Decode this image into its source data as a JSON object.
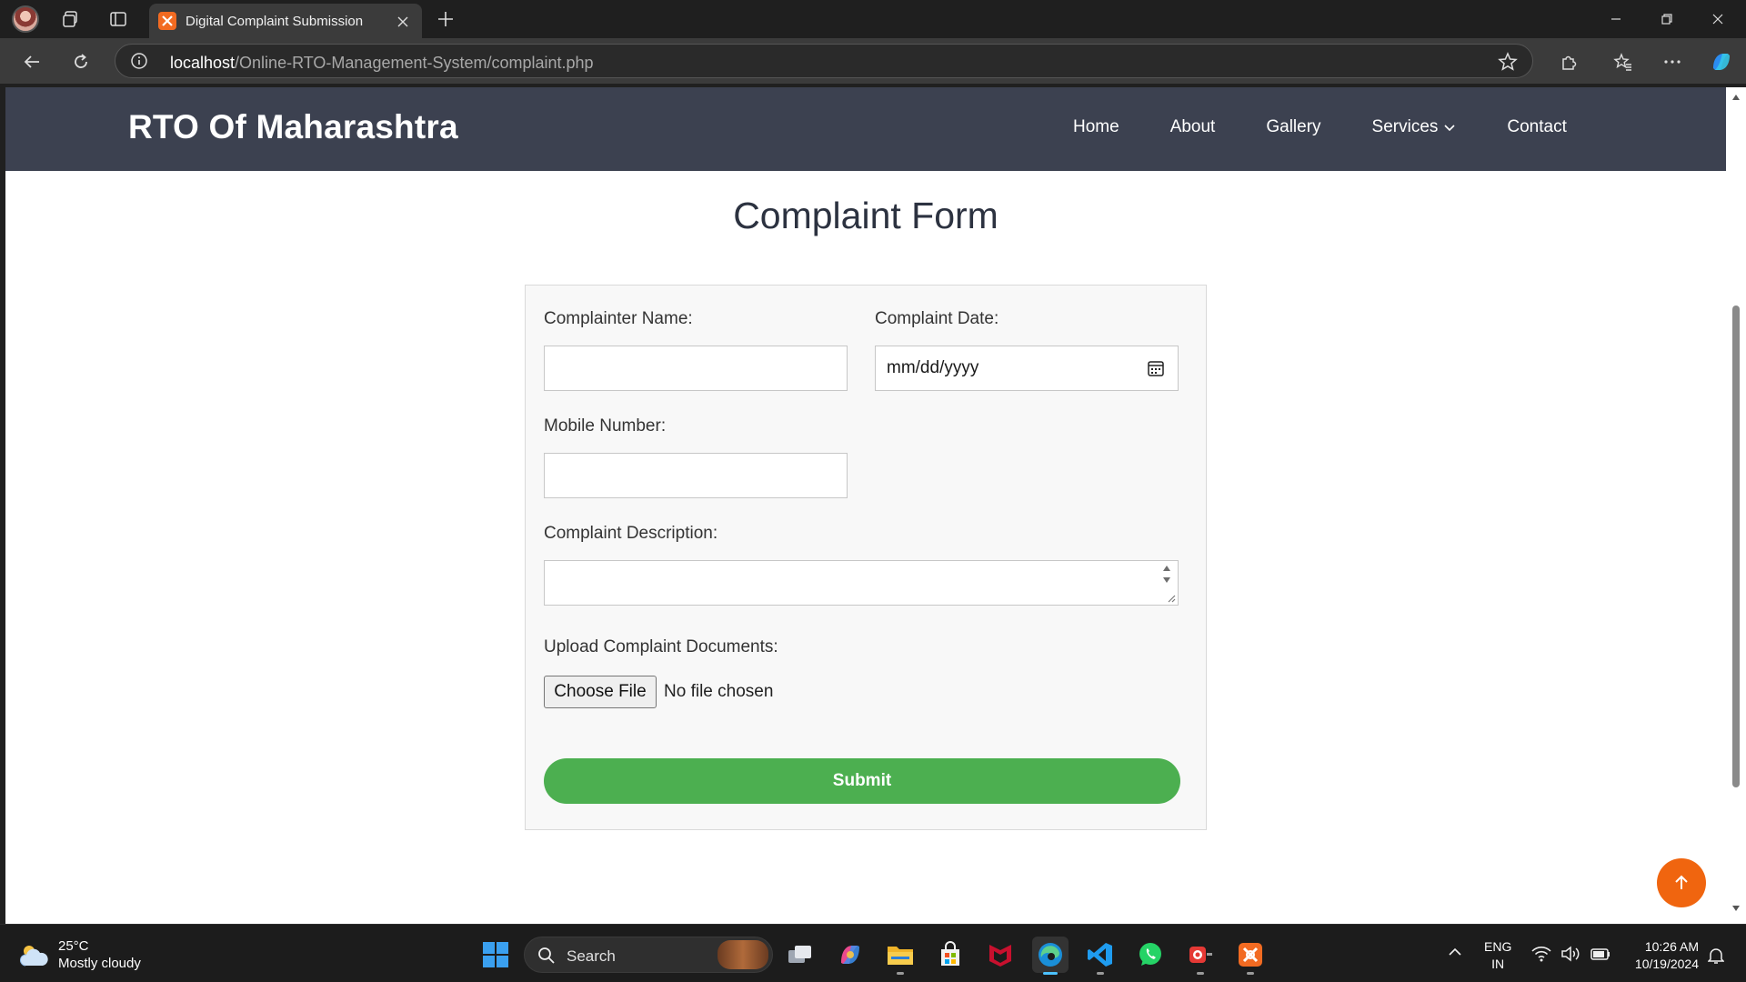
{
  "browser": {
    "tab_title": "Digital Complaint Submission",
    "url_host": "localhost",
    "url_path": "/Online-RTO-Management-System/complaint.php"
  },
  "site": {
    "logo": "RTO Of Maharashtra",
    "nav": [
      {
        "label": "Home"
      },
      {
        "label": "About"
      },
      {
        "label": "Gallery"
      },
      {
        "label": "Services"
      },
      {
        "label": "Contact"
      }
    ]
  },
  "form": {
    "title": "Complaint Form",
    "complainer_name_label": "Complainter Name:",
    "complainer_name_value": "",
    "date_label": "Complaint Date:",
    "date_placeholder": "mm/dd/yyyy",
    "mobile_label": "Mobile Number:",
    "mobile_value": "",
    "description_label": "Complaint Description:",
    "description_value": "",
    "upload_label": "Upload Complaint Documents:",
    "choose_file_label": "Choose File",
    "file_status": "No file chosen",
    "submit_label": "Submit"
  },
  "taskbar": {
    "weather_temp": "25°C",
    "weather_desc": "Mostly cloudy",
    "search_label": "Search",
    "lang_1": "ENG",
    "lang_2": "IN",
    "time": "10:26 AM",
    "date": "10/19/2024"
  },
  "colors": {
    "header_bg": "#3c4150",
    "submit_bg": "#4caf50",
    "back_to_top": "#f0650f"
  }
}
